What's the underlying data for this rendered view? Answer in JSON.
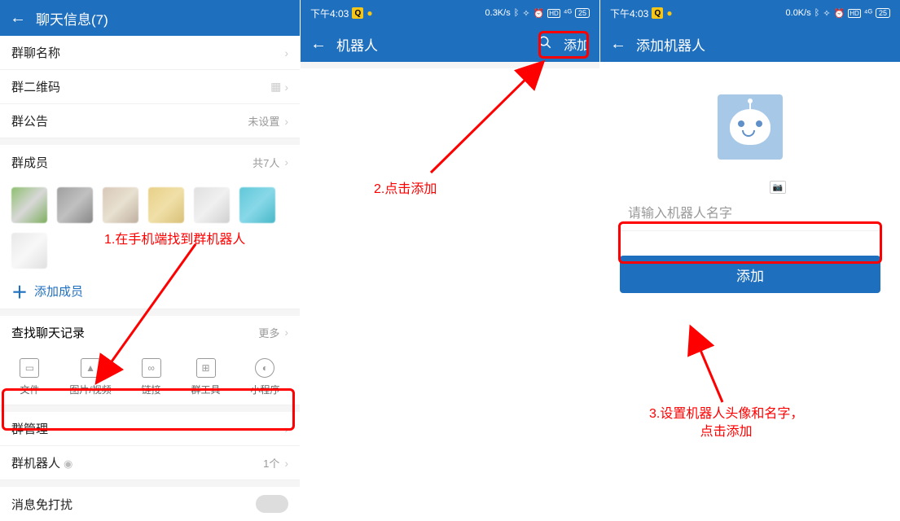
{
  "panel1": {
    "header_title": "聊天信息(7)",
    "rows": {
      "name_label": "群聊名称",
      "qr_label": "群二维码",
      "notice_label": "群公告",
      "notice_value": "未设置",
      "members_label": "群成员",
      "members_count": "共7人",
      "add_member": "添加成员",
      "search_label": "查找聊天记录",
      "search_more": "更多",
      "admin_label": "群管理",
      "robot_label": "群机器人",
      "robot_count": "1个",
      "dnd_label": "消息免打扰"
    },
    "tools": {
      "file": "文件",
      "image": "图片/视频",
      "link": "链接",
      "grouptool": "群工具",
      "miniapp": "小程序"
    }
  },
  "panel2": {
    "status_time": "下午4:03",
    "status_right": "0.3K/s",
    "battery": "25",
    "header_title": "机器人",
    "add_label": "添加"
  },
  "panel3": {
    "status_time": "下午4:03",
    "status_right": "0.0K/s",
    "battery": "25",
    "header_title": "添加机器人",
    "placeholder": "请输入机器人名字",
    "button": "添加"
  },
  "annotations": {
    "a1": "1.在手机端找到群机器人",
    "a2": "2.点击添加",
    "a3": "3.设置机器人头像和名字，\n点击添加"
  }
}
